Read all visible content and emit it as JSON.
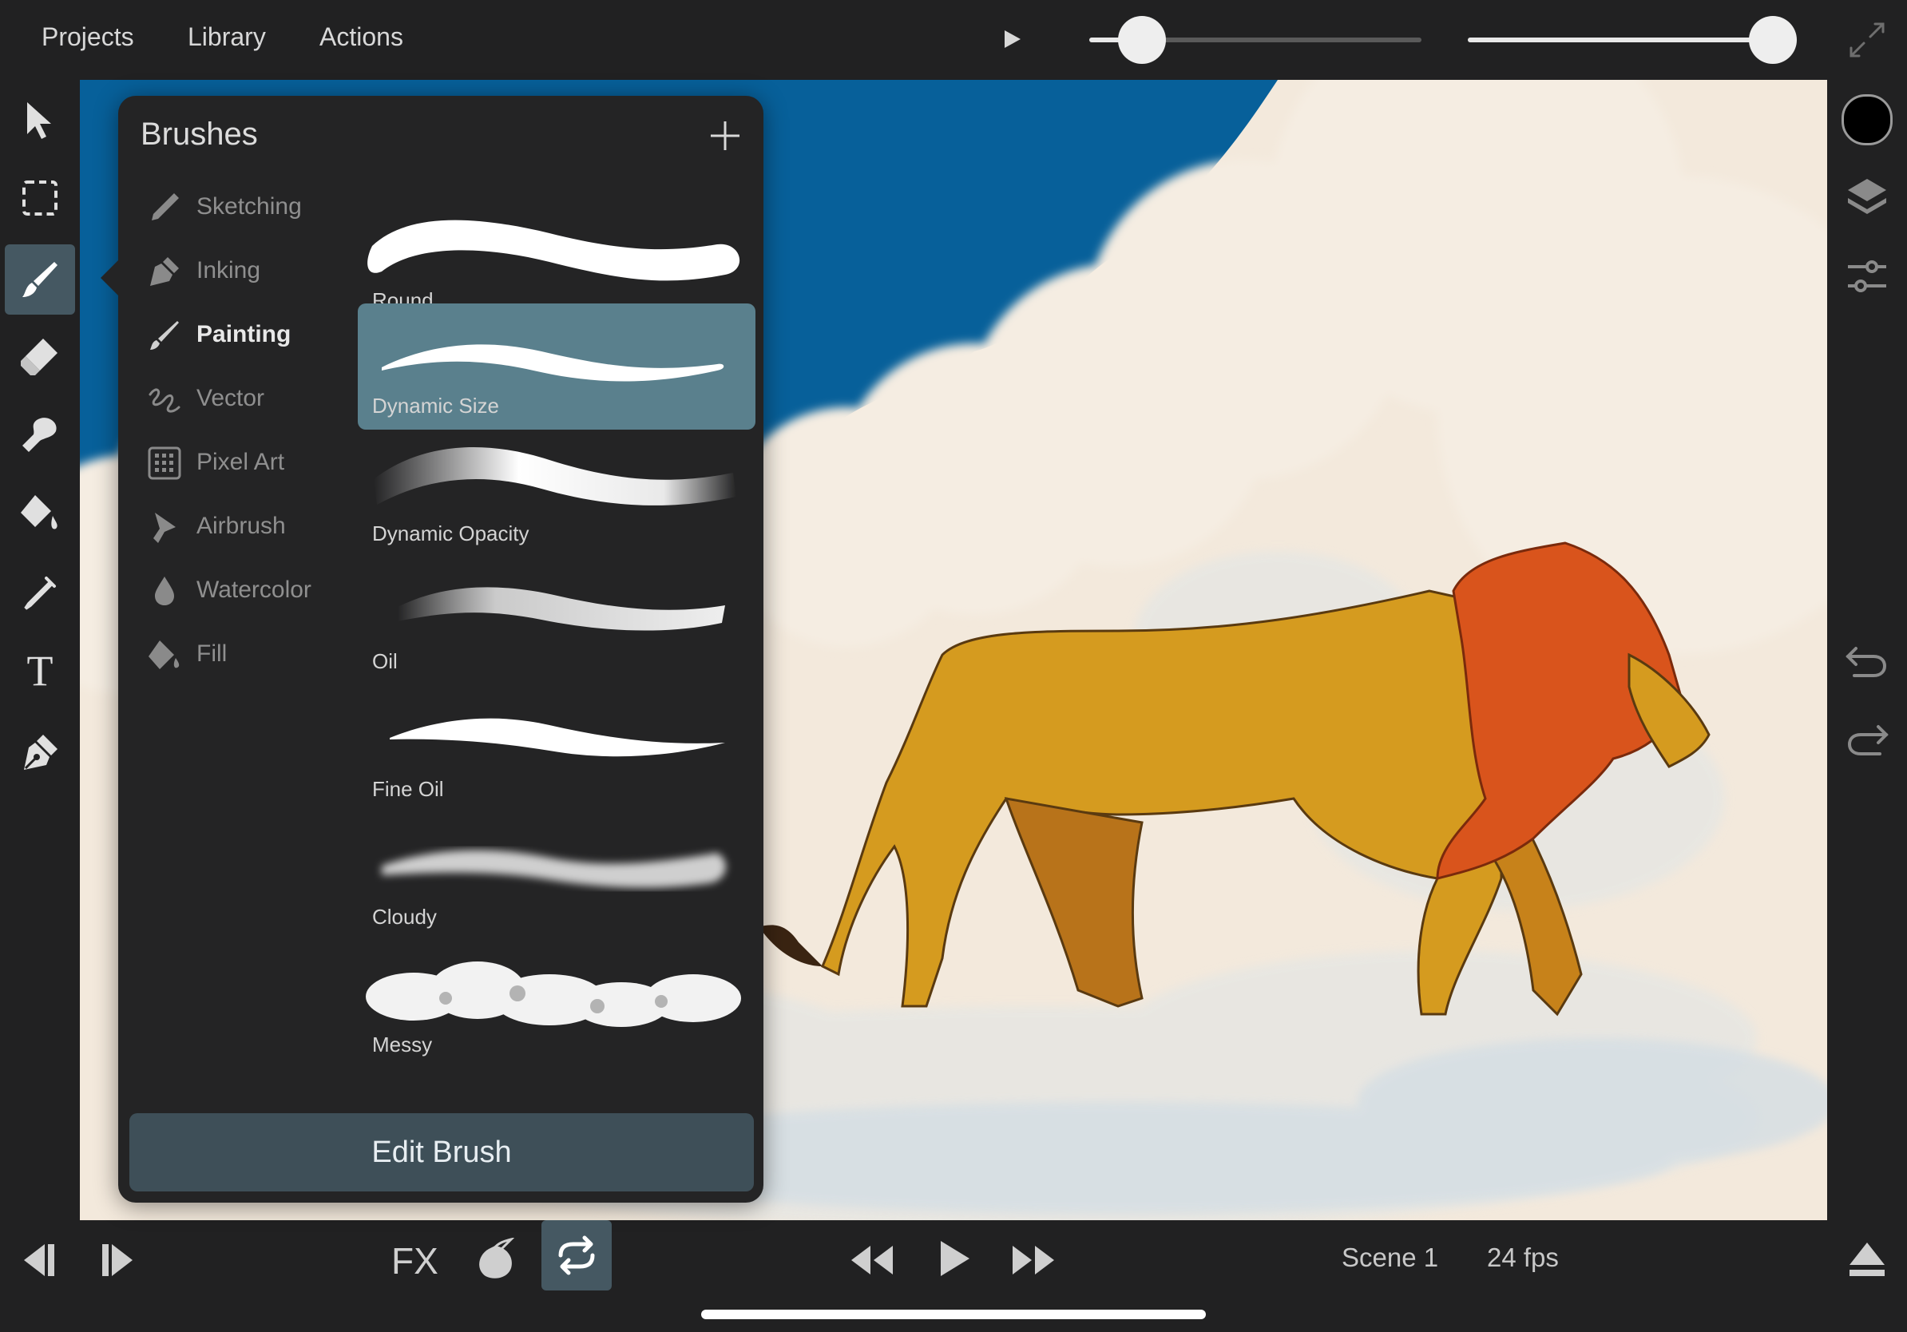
{
  "menu": {
    "projects": "Projects",
    "library": "Library",
    "actions": "Actions"
  },
  "top_controls": {
    "slider_1_level": 0.1,
    "slider_2_level": 1.0
  },
  "brushes_panel": {
    "title": "Brushes",
    "categories": [
      {
        "label": "Sketching",
        "icon": "pencil-icon"
      },
      {
        "label": "Inking",
        "icon": "pen-nib-icon"
      },
      {
        "label": "Painting",
        "icon": "paintbrush-icon",
        "active": true
      },
      {
        "label": "Vector",
        "icon": "vector-squiggle-icon"
      },
      {
        "label": "Pixel Art",
        "icon": "pixel-grid-icon"
      },
      {
        "label": "Airbrush",
        "icon": "airbrush-icon"
      },
      {
        "label": "Watercolor",
        "icon": "droplet-icon"
      },
      {
        "label": "Fill",
        "icon": "paint-bucket-icon"
      }
    ],
    "brushes": [
      {
        "label": "Round"
      },
      {
        "label": "Dynamic Size",
        "selected": true
      },
      {
        "label": "Dynamic Opacity"
      },
      {
        "label": "Oil"
      },
      {
        "label": "Fine Oil"
      },
      {
        "label": "Cloudy"
      },
      {
        "label": "Messy"
      }
    ],
    "edit_button": "Edit Brush"
  },
  "left_tools": [
    "select-arrow-icon",
    "marquee-select-icon",
    "brush-tool-icon",
    "eraser-icon",
    "smudge-icon",
    "fill-bucket-icon",
    "eyedropper-icon",
    "text-tool-icon",
    "pen-tool-icon"
  ],
  "right_tools": [
    "color-swatch",
    "layers-icon",
    "adjustments-icon",
    "undo-icon",
    "redo-icon"
  ],
  "colors": {
    "current_color": "#000000",
    "accent_selected": "#5a808d",
    "edit_button_bg": "#3e4f58",
    "sky": "#07609a",
    "lion_body": "#d59b1f",
    "lion_mane": "#d9541c"
  },
  "bottom_bar": {
    "fx_label": "FX",
    "scene": "Scene 1",
    "fps": "24 fps"
  }
}
